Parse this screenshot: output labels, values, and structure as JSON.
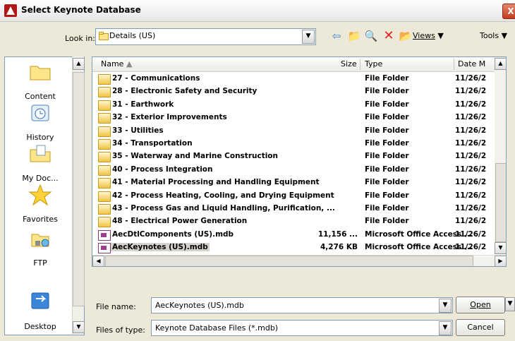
{
  "window": {
    "title": "Select Keynote Database",
    "close_label": "X"
  },
  "toolbar": {
    "look_in_label": "Look in:",
    "look_in_value": "Details (US)",
    "views_label": "Views",
    "tools_label": "Tools"
  },
  "places": [
    {
      "label": "Content",
      "icon": "folder-icon"
    },
    {
      "label": "History",
      "icon": "history-icon"
    },
    {
      "label": "My Doc...",
      "icon": "my-documents-icon"
    },
    {
      "label": "Favorites",
      "icon": "star-icon"
    },
    {
      "label": "FTP",
      "icon": "ftp-icon"
    },
    {
      "label": "Desktop",
      "icon": "desktop-icon"
    }
  ],
  "columns": {
    "name": "Name",
    "size": "Size",
    "type": "Type",
    "date": "Date M"
  },
  "files": [
    {
      "name": "27 - Communications",
      "size": "",
      "type": "File Folder",
      "date": "11/26/2",
      "kind": "folder"
    },
    {
      "name": "28 - Electronic Safety and Security",
      "size": "",
      "type": "File Folder",
      "date": "11/26/2",
      "kind": "folder"
    },
    {
      "name": "31 - Earthwork",
      "size": "",
      "type": "File Folder",
      "date": "11/26/2",
      "kind": "folder"
    },
    {
      "name": "32 - Exterior Improvements",
      "size": "",
      "type": "File Folder",
      "date": "11/26/2",
      "kind": "folder"
    },
    {
      "name": "33 - Utilities",
      "size": "",
      "type": "File Folder",
      "date": "11/26/2",
      "kind": "folder"
    },
    {
      "name": "34 - Transportation",
      "size": "",
      "type": "File Folder",
      "date": "11/26/2",
      "kind": "folder"
    },
    {
      "name": "35 - Waterway and Marine Construction",
      "size": "",
      "type": "File Folder",
      "date": "11/26/2",
      "kind": "folder"
    },
    {
      "name": "40 - Process Integration",
      "size": "",
      "type": "File Folder",
      "date": "11/26/2",
      "kind": "folder"
    },
    {
      "name": "41 - Material Processing and Handling Equipment",
      "size": "",
      "type": "File Folder",
      "date": "11/26/2",
      "kind": "folder"
    },
    {
      "name": "42 - Process Heating, Cooling, and Drying Equipment",
      "size": "",
      "type": "File Folder",
      "date": "11/26/2",
      "kind": "folder"
    },
    {
      "name": "43 - Process Gas and Liquid Handling, Purification, ...",
      "size": "",
      "type": "File Folder",
      "date": "11/26/2",
      "kind": "folder"
    },
    {
      "name": "48 - Electrical Power Generation",
      "size": "",
      "type": "File Folder",
      "date": "11/26/2",
      "kind": "folder"
    },
    {
      "name": "AecDtlComponents (US).mdb",
      "size": "11,156 ...",
      "type": "Microsoft Office Access ...",
      "date": "11/26/2",
      "kind": "mdb"
    },
    {
      "name": "AecKeynotes (US).mdb",
      "size": "4,276 KB",
      "type": "Microsoft Office Access ...",
      "date": "11/26/2",
      "kind": "mdb",
      "selected": true
    }
  ],
  "bottom": {
    "file_name_label": "File name:",
    "file_name_value": "AecKeynotes (US).mdb",
    "file_type_label": "Files of type:",
    "file_type_value": "Keynote Database Files (*.mdb)",
    "open_label": "Open",
    "cancel_label": "Cancel"
  }
}
